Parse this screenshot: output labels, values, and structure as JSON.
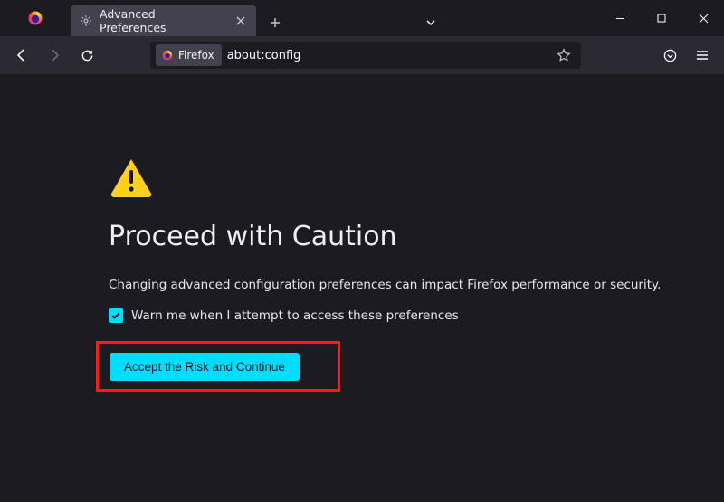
{
  "window": {
    "tab_title": "Advanced Preferences",
    "chevron_tooltip": "List all tabs"
  },
  "toolbar": {
    "identity_label": "Firefox",
    "url": "about:config"
  },
  "warning": {
    "heading": "Proceed with Caution",
    "description": "Changing advanced configuration preferences can impact Firefox performance or security.",
    "checkbox_label": "Warn me when I attempt to access these preferences",
    "accept_button": "Accept the Risk and Continue"
  }
}
